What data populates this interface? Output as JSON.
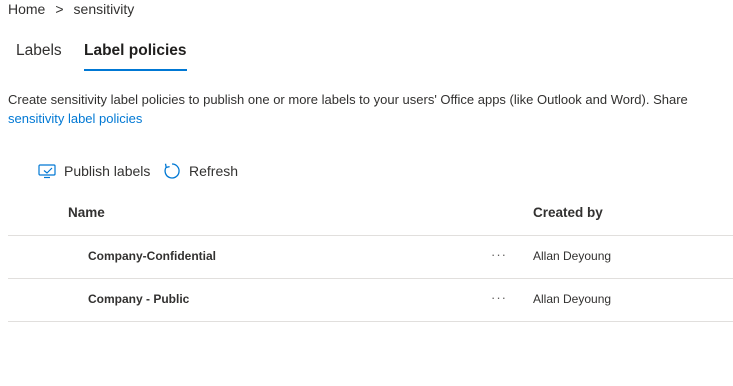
{
  "breadcrumb": {
    "home": "Home",
    "separator": ">",
    "current": "sensitivity"
  },
  "tabs": [
    {
      "label": "Labels",
      "selected": false
    },
    {
      "label": "Label policies",
      "selected": true
    }
  ],
  "description": {
    "text": "Create sensitivity label policies to publish one or more labels to your users' Office apps (like Outlook and Word). Share",
    "link": "sensitivity label policies"
  },
  "toolbar": {
    "publish": {
      "label": "Publish labels",
      "icon": "publish-icon"
    },
    "refresh": {
      "label": "Refresh",
      "icon": "refresh-icon"
    }
  },
  "table": {
    "columns": {
      "name": "Name",
      "created_by": "Created by"
    },
    "rows": [
      {
        "name": "Company-Confidential",
        "more": "···",
        "created_by": "Allan Deyoung"
      },
      {
        "name": "Company - Public",
        "more": "···",
        "created_by": "Allan Deyoung"
      }
    ]
  },
  "colors": {
    "accent": "#0078d4",
    "text": "#323130",
    "divider": "#e1dfdd"
  }
}
